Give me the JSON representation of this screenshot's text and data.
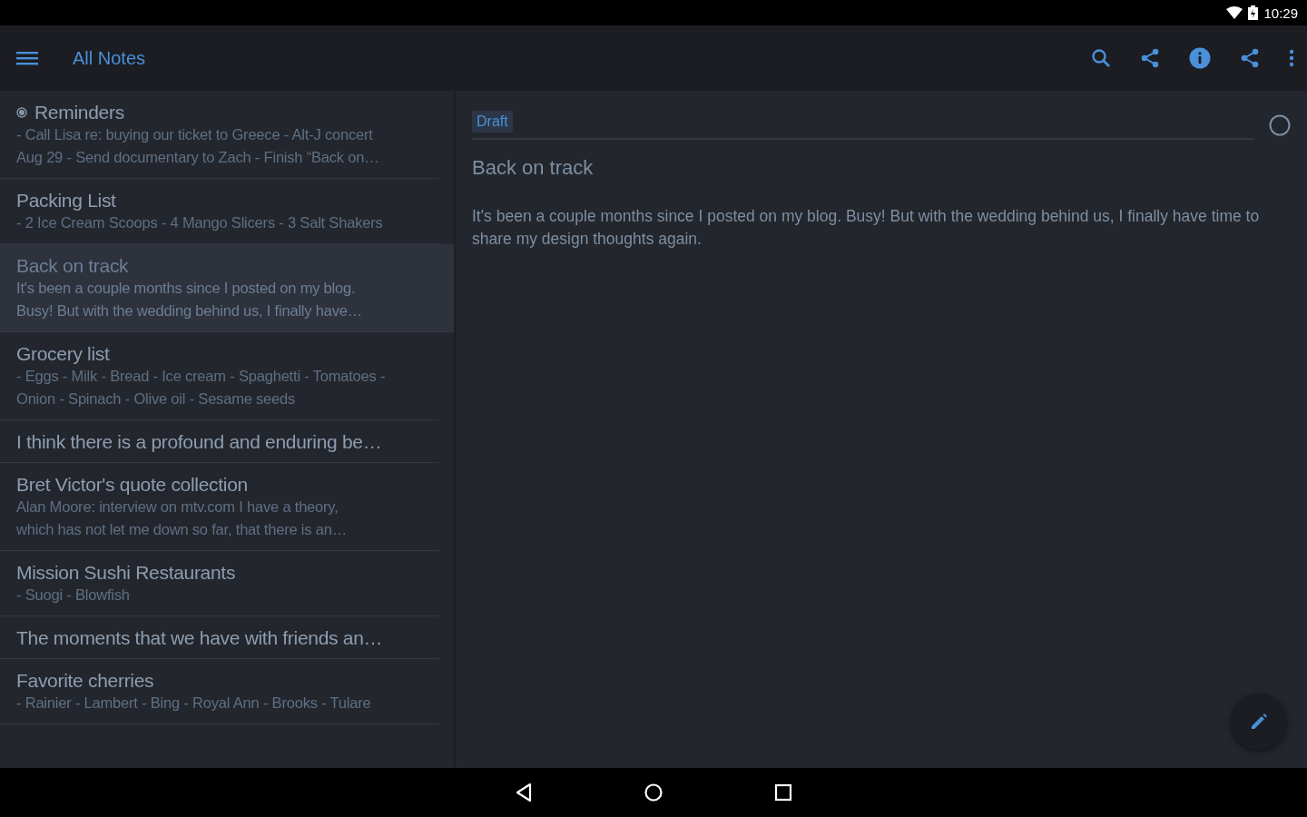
{
  "status_bar": {
    "time": "10:29"
  },
  "toolbar": {
    "title": "All Notes"
  },
  "notes": [
    {
      "title": "Reminders",
      "pinned": true,
      "selected": false,
      "preview": [
        "- Call Lisa re: buying our ticket to Greece - Alt-J concert",
        "Aug 29 - Send documentary to Zach - Finish “Back on…"
      ]
    },
    {
      "title": "Packing List",
      "pinned": false,
      "selected": false,
      "preview": [
        "- 2 Ice Cream Scoops - 4 Mango Slicers - 3 Salt Shakers"
      ]
    },
    {
      "title": "Back on track",
      "pinned": false,
      "selected": true,
      "preview": [
        "It's been a couple months since I posted on my blog.",
        "Busy! But with the wedding behind us, I finally have…"
      ]
    },
    {
      "title": "Grocery list",
      "pinned": false,
      "selected": false,
      "preview": [
        "- Eggs - Milk - Bread - Ice cream - Spaghetti - Tomatoes -",
        "Onion - Spinach - Olive oil - Sesame seeds"
      ]
    },
    {
      "title": "I think there is a profound and enduring be…",
      "pinned": false,
      "selected": false
    },
    {
      "title": "Bret Victor's quote collection",
      "pinned": false,
      "selected": false,
      "preview": [
        "Alan Moore: interview on mtv.com I have a theory,",
        "which has not let me down so far, that there is an…"
      ]
    },
    {
      "title": "Mission Sushi Restaurants",
      "pinned": false,
      "selected": false,
      "preview": [
        "- Suogi - Blowfish"
      ]
    },
    {
      "title": "The moments that we have with friends an…",
      "pinned": false,
      "selected": false
    },
    {
      "title": "Favorite cherries",
      "pinned": false,
      "selected": false,
      "preview": [
        "- Rainier - Lambert - Bing - Royal Ann - Brooks - Tulare"
      ]
    }
  ],
  "editor": {
    "tags": [
      "Draft"
    ],
    "title": "Back on track",
    "body": "It's been a couple months since I posted on my blog. Busy! But with the wedding behind us, I finally have time to share my design thoughts again."
  }
}
